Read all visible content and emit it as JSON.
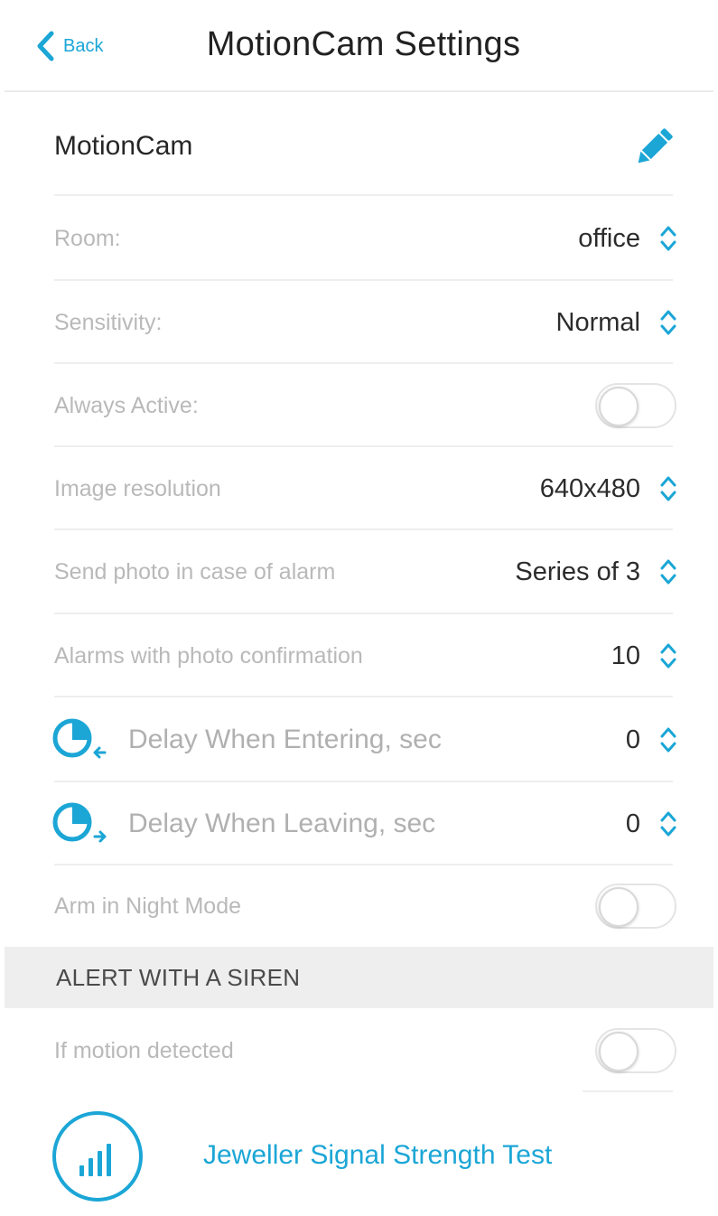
{
  "header": {
    "back_label": "Back",
    "title": "MotionCam Settings"
  },
  "device": {
    "name": "MotionCam",
    "edit_icon": "pencil-icon"
  },
  "settings": {
    "room": {
      "label": "Room:",
      "value": "office"
    },
    "sensitivity": {
      "label": "Sensitivity:",
      "value": "Normal"
    },
    "always_active": {
      "label": "Always Active:",
      "on": false
    },
    "image_resolution": {
      "label": "Image resolution",
      "value": "640x480"
    },
    "send_photo": {
      "label": "Send photo in case of alarm",
      "value": "Series of 3"
    },
    "alarms_photo": {
      "label": "Alarms with photo confirmation",
      "value": "10"
    },
    "delay_entering": {
      "label": "Delay When Entering, sec",
      "value": "0",
      "icon": "clock-arrow-in-icon"
    },
    "delay_leaving": {
      "label": "Delay When Leaving, sec",
      "value": "0",
      "icon": "clock-arrow-out-icon"
    },
    "night_mode": {
      "label": "Arm in Night Mode",
      "on": false
    }
  },
  "siren_section": {
    "title": "ALERT WITH A SIREN",
    "motion_detected": {
      "label": "If motion detected",
      "on": false
    }
  },
  "signal_test": {
    "label": "Jeweller Signal Strength Test",
    "icon": "signal-bars-icon"
  },
  "colors": {
    "accent": "#1ba6d6",
    "label_gray": "#b9b9b9",
    "section_bg": "#eeeeee"
  }
}
